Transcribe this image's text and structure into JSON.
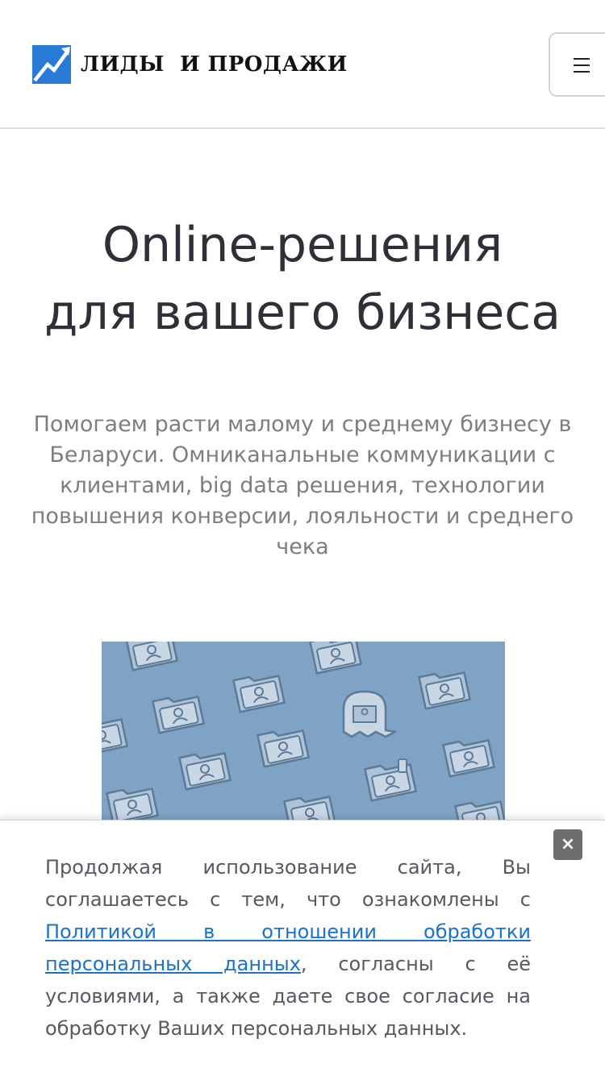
{
  "header": {
    "logo_text": "ЛИДЫ  И ПРОДАЖИ",
    "menu_icon": "hamburger-menu-icon",
    "brand_color": "#2979d6"
  },
  "hero": {
    "title_line1": "Online-решения",
    "title_line2": "для вашего бизнеса",
    "subtitle": "Помогаем расти малому и среднему бизнесу в Беларуси. Омниканальные коммуникации с клиентами, big data решения, технологии повышения конверсии, лояльности и среднего чека"
  },
  "illustration": {
    "description_icon": "contact-folders-illustration",
    "background_color": "#7fa3c4"
  },
  "cookie_banner": {
    "text_before": "Продолжая использование сайта, Вы соглашаетесь с тем, что ознакомлены с ",
    "link_text": "Политикой в отношении обработки персональных данных",
    "text_after": ", согласны с её условиями, а также даете свое согласие на обработку Ваших персональных данных.",
    "close_label": "×"
  }
}
